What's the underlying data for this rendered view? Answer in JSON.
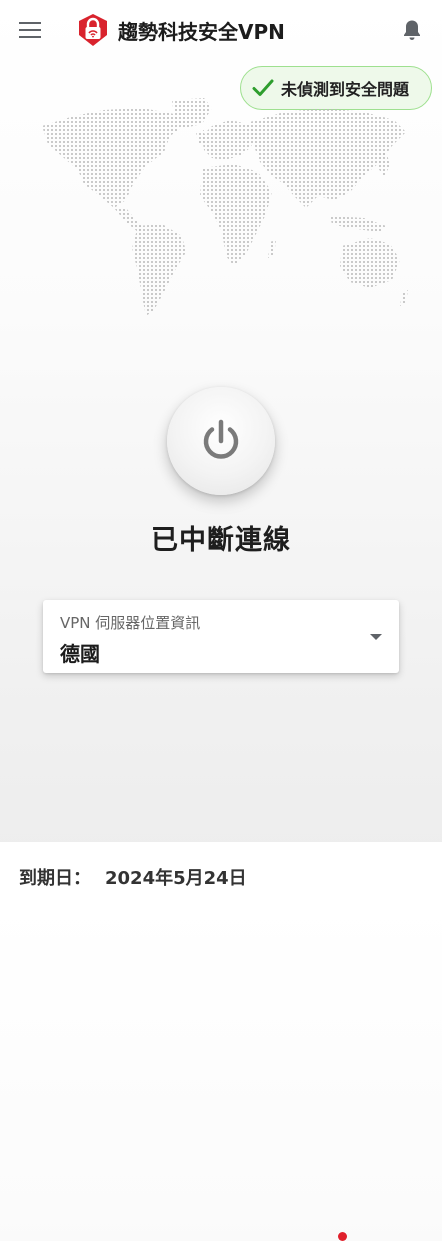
{
  "app_bar": {
    "title": "趨勢科技安全VPN",
    "menu_icon": "hamburger-menu-icon",
    "logo_icon": "shield-lock-icon",
    "notification_icon": "bell-icon"
  },
  "security_badge": {
    "text": "未偵測到安全問題",
    "icon": "checkmark-icon",
    "color": "#2e9e2e"
  },
  "connection": {
    "status": "已中斷連線",
    "power_icon": "power-icon"
  },
  "server": {
    "label": "VPN 伺服器位置資訊",
    "location": "德國",
    "status_color": "#e0202c",
    "dropdown_icon": "caret-down-icon"
  },
  "footer": {
    "expiry_label": "到期日：",
    "expiry_date": "2024年5月24日"
  },
  "colors": {
    "brand": "#d9232d",
    "success_border": "#9ee08f",
    "success_bg": "#eef9ea",
    "icon_gray": "#5f6368"
  }
}
